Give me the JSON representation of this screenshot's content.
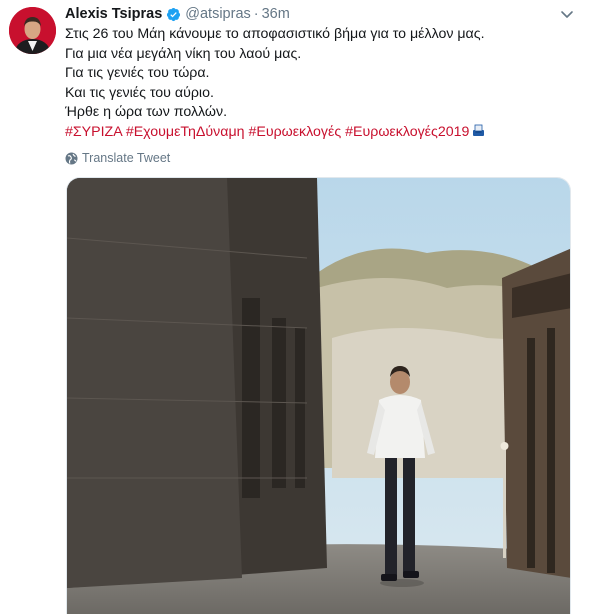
{
  "tweet": {
    "author_name": "Alexis Tsipras",
    "handle": "@atsipras",
    "separator": "·",
    "time": "36m",
    "lines": [
      "Στις 26 του Μάη κάνουμε το αποφασιστικό βήμα για το μέλλον μας.",
      "Για μια νέα μεγάλη νίκη του λαού μας.",
      "Για τις γενιές του τώρα.",
      "Και τις γενιές του αύριο.",
      "Ήρθε η ώρα των πολλών."
    ],
    "hashtags": [
      "#ΣΥΡΙΖΑ",
      "#ΕχουμεΤηΔύναμη",
      "#Ευρωεκλογές",
      "#Ευρωεκλογές2019"
    ],
    "translate_label": "Translate Tweet"
  },
  "colors": {
    "hashtag": "#c8102e",
    "verified": "#1da1f2",
    "secondary_text": "#657786"
  },
  "icons": {
    "verified": "verified-badge-icon",
    "caret": "chevron-down-icon",
    "globe": "globe-icon",
    "emoji": "ballot-box-emoji-icon"
  }
}
